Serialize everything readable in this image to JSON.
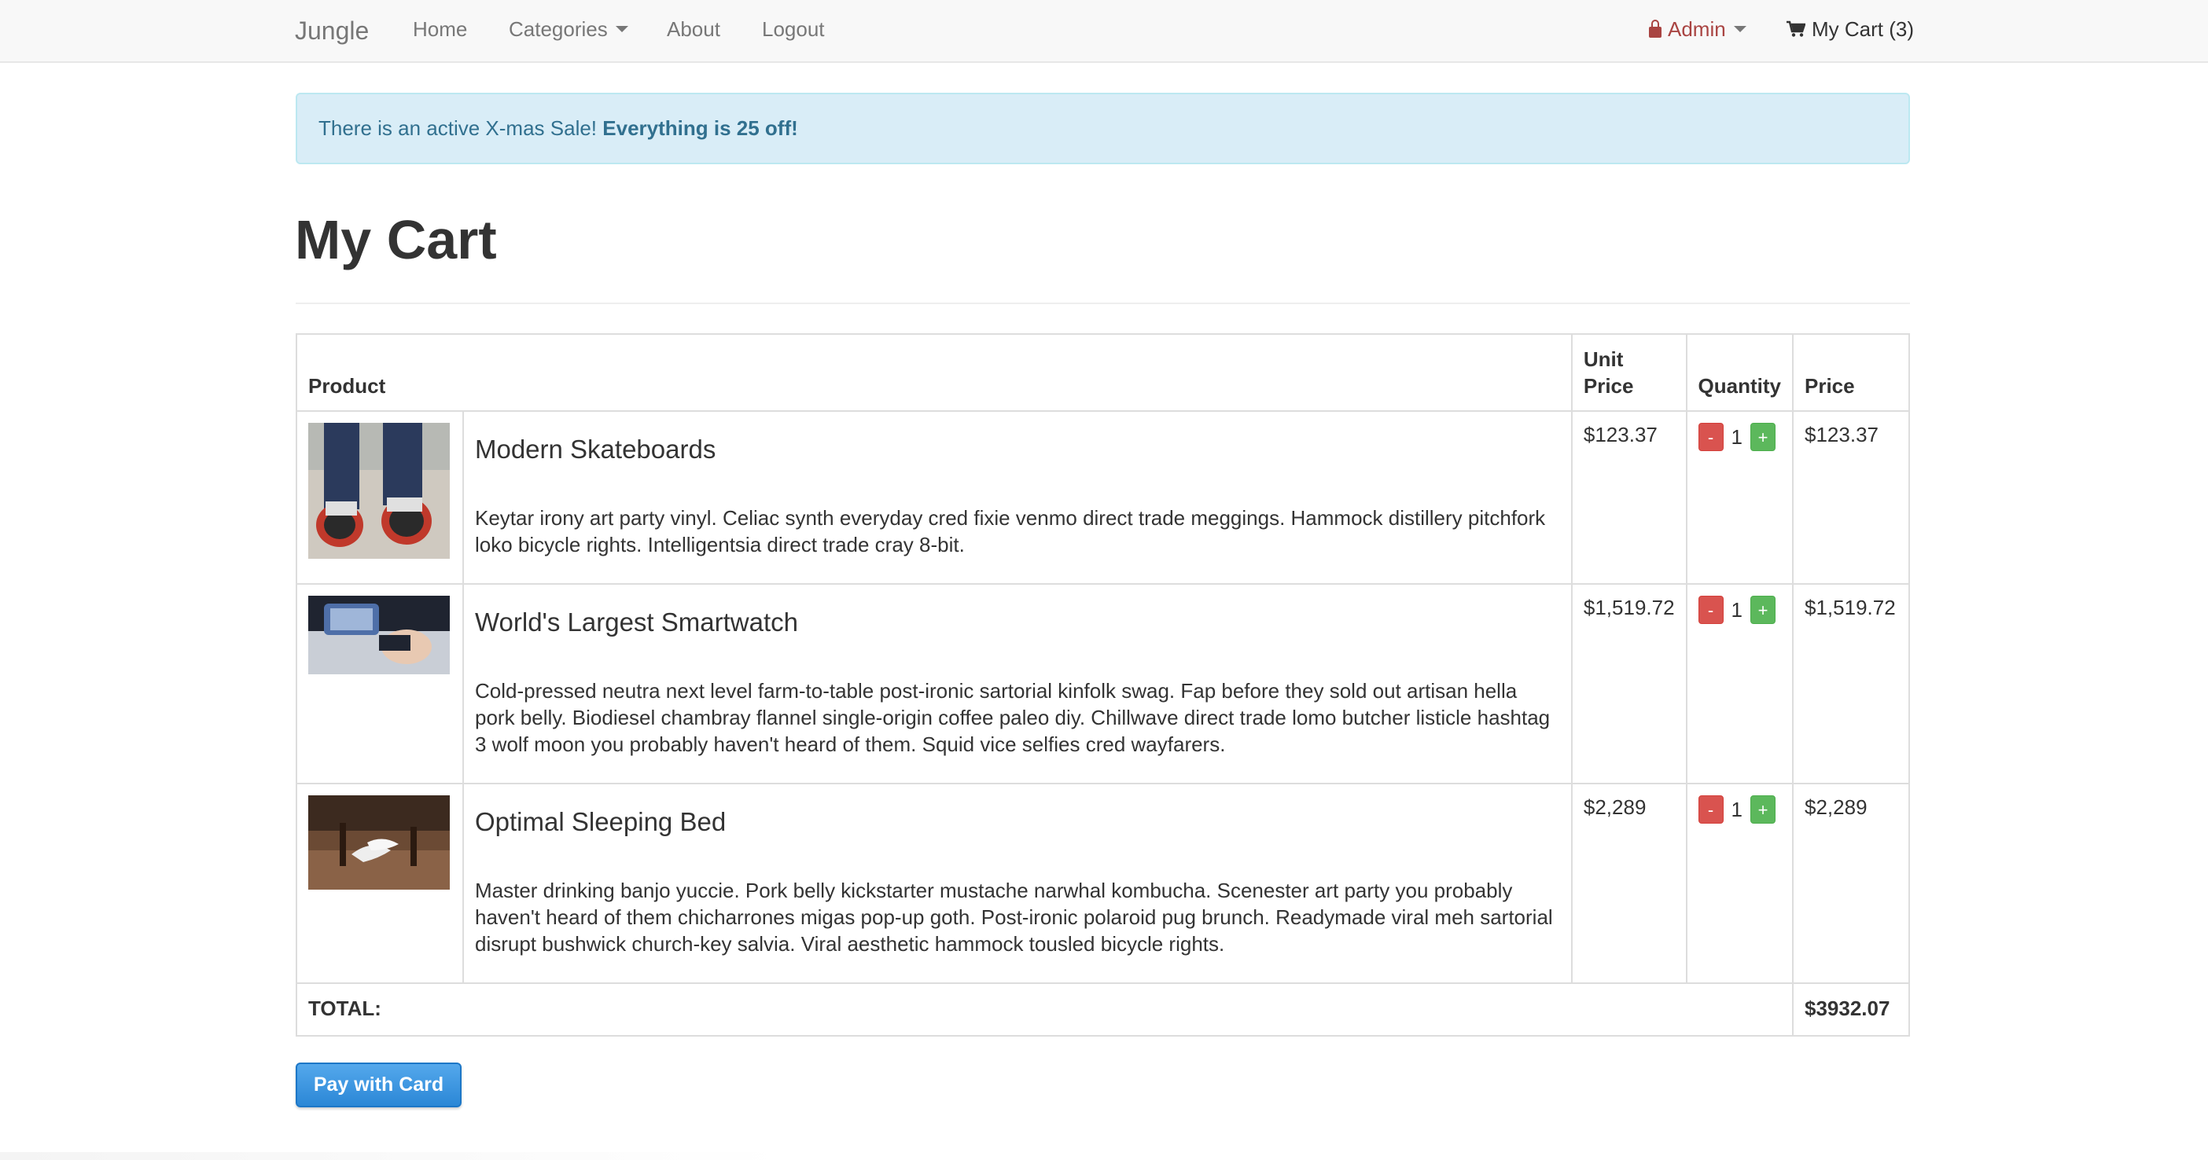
{
  "nav": {
    "brand": "Jungle",
    "links": [
      {
        "label": "Home"
      },
      {
        "label": "Categories"
      },
      {
        "label": "About"
      },
      {
        "label": "Logout"
      }
    ],
    "admin_label": "Admin",
    "cart_label": "My Cart (3)"
  },
  "alert": {
    "text": "There is an active X-mas Sale!",
    "emphasis": "Everything is 25 off!"
  },
  "page_title": "My Cart",
  "table": {
    "headers": {
      "product": "Product",
      "unit_price": "Unit Price",
      "quantity": "Quantity",
      "price": "Price"
    },
    "rows": [
      {
        "name": "Modern Skateboards",
        "description": "Keytar irony art party vinyl. Celiac synth everyday cred fixie venmo direct trade meggings. Hammock distillery pitchfork loko bicycle rights. Intelligentsia direct trade cray 8-bit.",
        "unit_price": "$123.37",
        "quantity": "1",
        "price": "$123.37"
      },
      {
        "name": "World's Largest Smartwatch",
        "description": "Cold-pressed neutra next level farm-to-table post-ironic sartorial kinfolk swag. Fap before they sold out artisan hella pork belly. Biodiesel chambray flannel single-origin coffee paleo diy. Chillwave direct trade lomo butcher listicle hashtag 3 wolf moon you probably haven't heard of them. Squid vice selfies cred wayfarers.",
        "unit_price": "$1,519.72",
        "quantity": "1",
        "price": "$1,519.72"
      },
      {
        "name": "Optimal Sleeping Bed",
        "description": "Master drinking banjo yuccie. Pork belly kickstarter mustache narwhal kombucha. Scenester art party you probably haven't heard of them chicharrones migas pop-up goth. Post-ironic polaroid pug brunch. Readymade viral meh sartorial disrupt bushwick church-key salvia. Viral aesthetic hammock tousled bicycle rights.",
        "unit_price": "$2,289",
        "quantity": "1",
        "price": "$2,289"
      }
    ],
    "minus_label": "-",
    "plus_label": "+",
    "total_label": "TOTAL:",
    "total_value": "$3932.07"
  },
  "pay_button": "Pay with Card",
  "colors": {
    "alert_bg": "#d9edf7",
    "alert_text": "#31708f",
    "admin": "#a94442",
    "minus_btn": "#d9534f",
    "plus_btn": "#5cb85c",
    "pay_btn": "#2b87d6"
  }
}
